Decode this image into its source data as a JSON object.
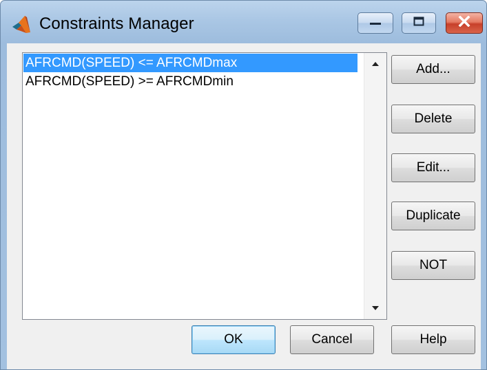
{
  "window": {
    "title": "Constraints Manager",
    "minimize_icon": "minimize-icon",
    "maximize_icon": "maximize-icon",
    "close_icon": "close-icon",
    "app_icon": "matlab-logo-icon"
  },
  "constraints": {
    "items": [
      {
        "label": "AFRCMD(SPEED) <= AFRCMDmax",
        "selected": true
      },
      {
        "label": "AFRCMD(SPEED) >= AFRCMDmin",
        "selected": false
      }
    ],
    "scroll_up_icon": "triangle-up-icon",
    "scroll_down_icon": "triangle-down-icon"
  },
  "side_buttons": {
    "add": "Add...",
    "delete": "Delete",
    "edit": "Edit...",
    "duplicate": "Duplicate",
    "not": "NOT"
  },
  "footer_buttons": {
    "ok": "OK",
    "cancel": "Cancel",
    "help": "Help"
  },
  "colors": {
    "selection": "#3399ff",
    "title_bar": "#a9c6e4",
    "close_button": "#c7402a"
  }
}
